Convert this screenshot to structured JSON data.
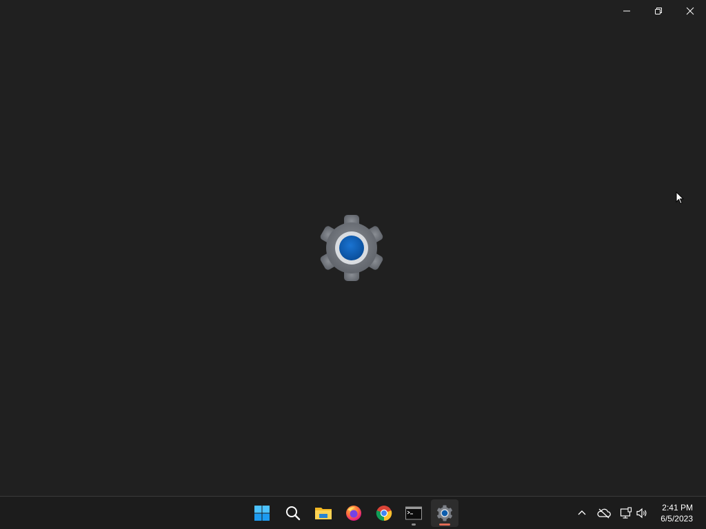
{
  "window": {
    "title_visible": "",
    "caption_buttons": [
      "minimize",
      "restore",
      "close"
    ],
    "splash_icon": "settings-gear-icon"
  },
  "taskbar": {
    "pinned": [
      {
        "name": "start",
        "icon": "windows-start-icon"
      },
      {
        "name": "search",
        "icon": "search-icon"
      },
      {
        "name": "file-explorer",
        "icon": "folder-icon"
      },
      {
        "name": "firefox",
        "icon": "firefox-icon"
      },
      {
        "name": "chrome",
        "icon": "chrome-icon"
      },
      {
        "name": "terminal",
        "icon": "terminal-icon",
        "open": true
      },
      {
        "name": "settings",
        "icon": "settings-gear-icon",
        "open": true,
        "focused": true
      }
    ],
    "tray": {
      "icons": [
        "chevron-up-icon",
        "onedrive-offline-icon",
        "network-icon",
        "volume-icon"
      ],
      "clock": {
        "time": "2:41 PM",
        "date": "6/5/2023"
      }
    }
  },
  "colors": {
    "background": "#202020",
    "taskbar": "#1c1c1c",
    "accent_blue": "#0b5cad",
    "focus_indicator": "#e36b55"
  }
}
